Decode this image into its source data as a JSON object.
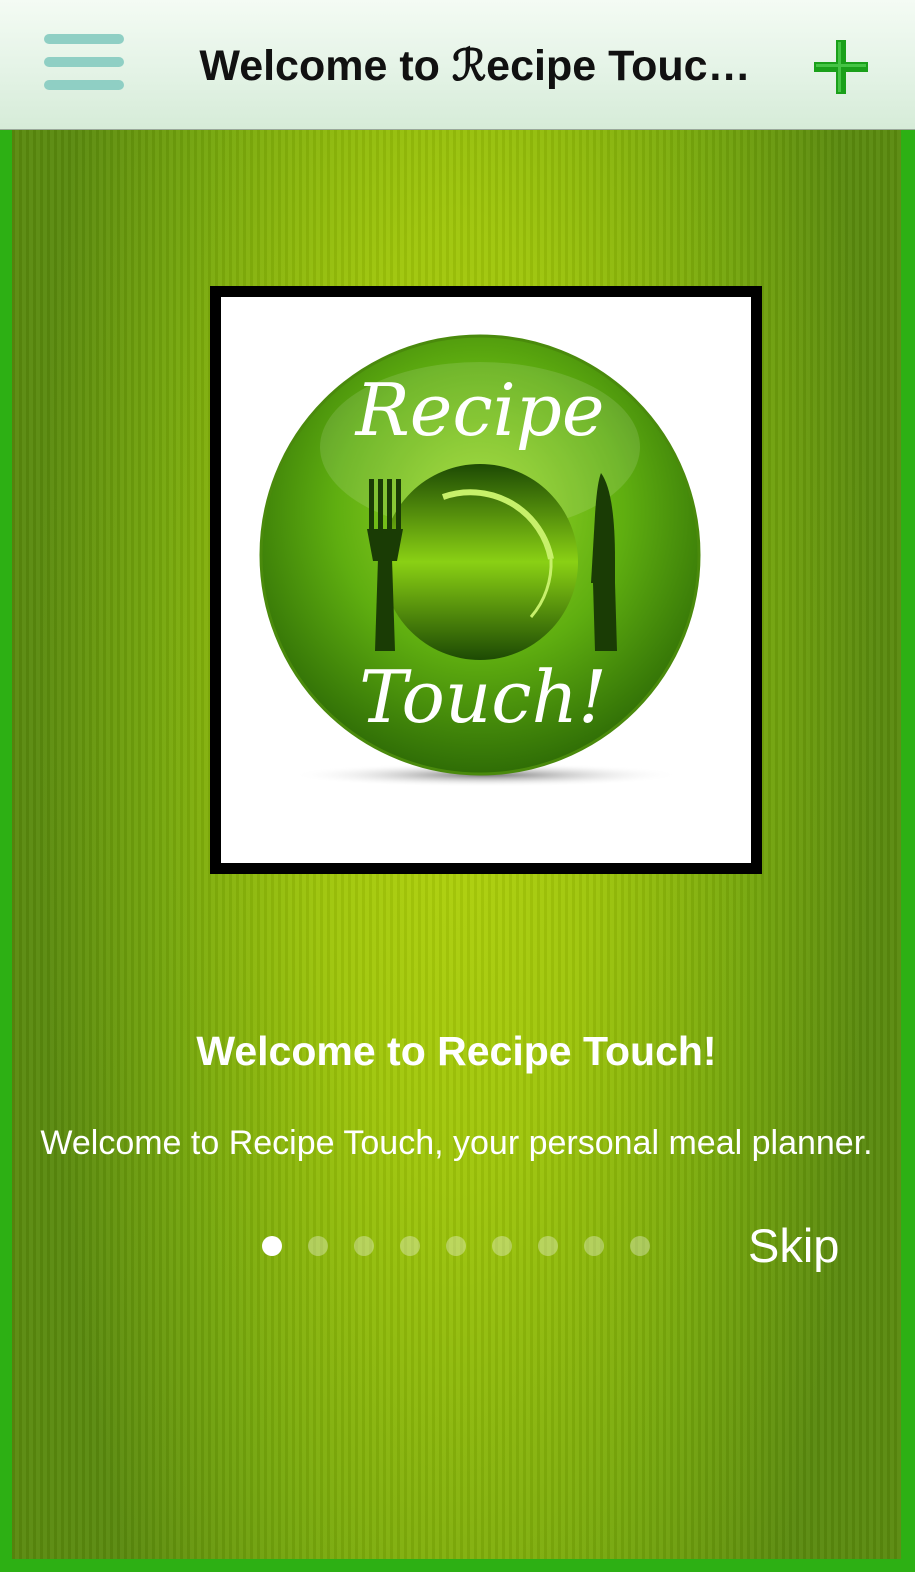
{
  "navbar": {
    "title": "Welcome to ℛecipe Touc…",
    "menu_icon": "hamburger-menu-icon",
    "add_icon": "plus-icon"
  },
  "logo": {
    "top_text": "Recipe",
    "bottom_text": "Touch!"
  },
  "onboarding": {
    "title": "Welcome to Recipe Touch!",
    "subtitle": "Welcome to Recipe Touch, your personal meal planner.",
    "page_count": 9,
    "current_page": 1,
    "skip_label": "Skip"
  },
  "colors": {
    "accent": "#1aa01a",
    "menu_icon": "#8fcfc4",
    "background": "#2db014"
  }
}
